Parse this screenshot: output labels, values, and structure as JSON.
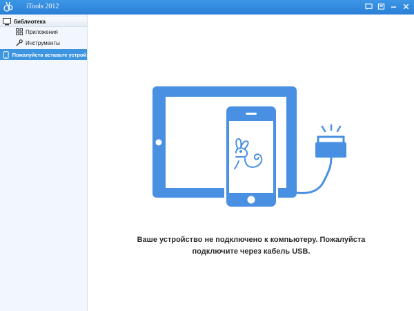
{
  "window": {
    "title": "iTools 2012",
    "logo_icon": "itools-rabbit-logo-icon",
    "controls": [
      "feedback-icon",
      "skin-icon",
      "minimize-icon",
      "close-icon"
    ]
  },
  "sidebar": {
    "library_label": "библиотека",
    "items": [
      {
        "label": "Приложения",
        "icon": "apps-grid-icon"
      },
      {
        "label": "Инструменты",
        "icon": "tools-icon"
      }
    ],
    "device_label": "Пожалуйста вставьте устрой..."
  },
  "main": {
    "message_line1": "Ваше устройство не подключено к компьютеру. Пожалуйста",
    "message_line2": "подключите через кабель USB."
  },
  "colors": {
    "accent": "#4a90e2",
    "titlebar": "#2f86dc",
    "sidebar_bg": "#f2f7fd",
    "selected_row": "#3d95e0"
  }
}
